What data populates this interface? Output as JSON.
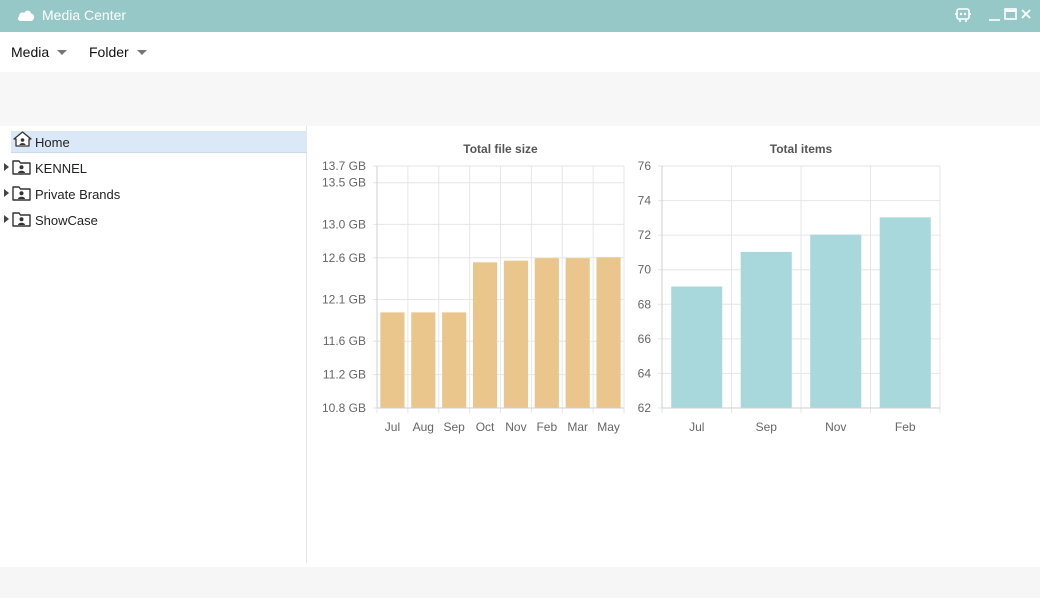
{
  "window": {
    "title": "Media Center",
    "icons": [
      "cloud-icon",
      "plugin-icon",
      "minimize-icon",
      "maximize-icon",
      "close-icon"
    ]
  },
  "menubar": {
    "items": [
      {
        "label": "Media"
      },
      {
        "label": "Folder"
      }
    ]
  },
  "tree": {
    "items": [
      {
        "label": "Home",
        "icon": "home-icon",
        "selected": true,
        "expandable": false
      },
      {
        "label": "KENNEL",
        "icon": "folder-user-icon",
        "selected": false,
        "expandable": true
      },
      {
        "label": "Private Brands",
        "icon": "folder-user-icon",
        "selected": false,
        "expandable": true
      },
      {
        "label": "ShowCase",
        "icon": "folder-user-icon",
        "selected": false,
        "expandable": true
      }
    ]
  },
  "colors": {
    "titlebar": "#96c8c8",
    "bar_file_size": "#ebc68c",
    "bar_items": "#a8d8dc",
    "selection": "#dbe8f8"
  },
  "chart_data": [
    {
      "type": "bar",
      "title": "Total file size",
      "categories": [
        "Jul",
        "Aug",
        "Sep",
        "Oct",
        "Nov",
        "Feb",
        "Mar",
        "May"
      ],
      "values": [
        11.94,
        11.94,
        11.94,
        12.54,
        12.56,
        12.59,
        12.59,
        12.6
      ],
      "unit": "GB",
      "ylim": [
        10.8,
        13.7
      ],
      "yticks": [
        10.8,
        11.2,
        11.6,
        12.1,
        12.6,
        13.0,
        13.5,
        13.7
      ],
      "ytick_labels": [
        "10.8 GB",
        "11.2 GB",
        "11.6 GB",
        "12.1 GB",
        "12.6 GB",
        "13.0 GB",
        "13.5 GB",
        "13.7 GB"
      ],
      "grid": true,
      "color": "#ebc68c"
    },
    {
      "type": "bar",
      "title": "Total items",
      "categories": [
        "Jul",
        "Sep",
        "Nov",
        "Feb"
      ],
      "values": [
        69,
        71,
        72,
        73
      ],
      "ylim": [
        62,
        76
      ],
      "yticks": [
        62,
        64,
        66,
        68,
        70,
        72,
        74,
        76
      ],
      "ytick_labels": [
        "62",
        "64",
        "66",
        "68",
        "70",
        "72",
        "74",
        "76"
      ],
      "grid": true,
      "color": "#a8d8dc"
    }
  ]
}
